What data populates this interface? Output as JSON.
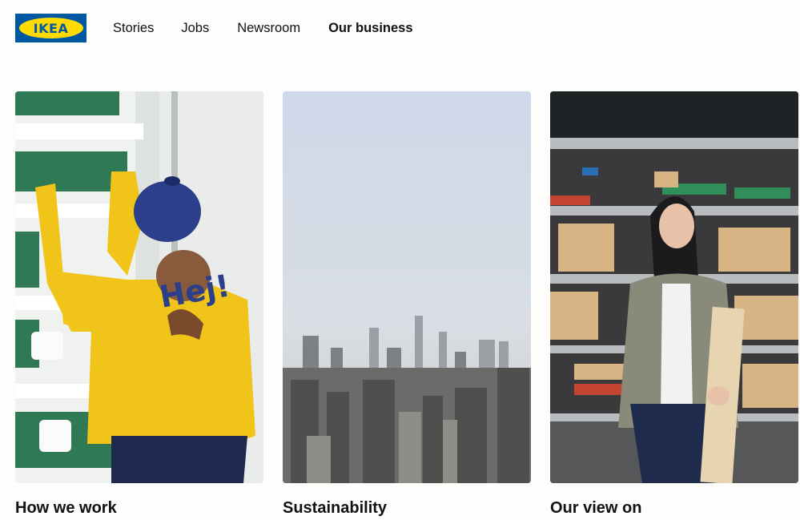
{
  "brand": {
    "logo_text": "IKEA"
  },
  "nav": {
    "items": [
      {
        "label": "Stories",
        "active": false
      },
      {
        "label": "Jobs",
        "active": false
      },
      {
        "label": "Newsroom",
        "active": false
      },
      {
        "label": "Our business",
        "active": true
      }
    ]
  },
  "cards": [
    {
      "title": "How we work",
      "image_text": "Hej!"
    },
    {
      "title": "Sustainability"
    },
    {
      "title": "Our view on"
    }
  ],
  "colors": {
    "ikea_blue": "#0058a3",
    "ikea_yellow": "#ffdb00",
    "text": "#111111",
    "background": "#fdfdfb"
  }
}
